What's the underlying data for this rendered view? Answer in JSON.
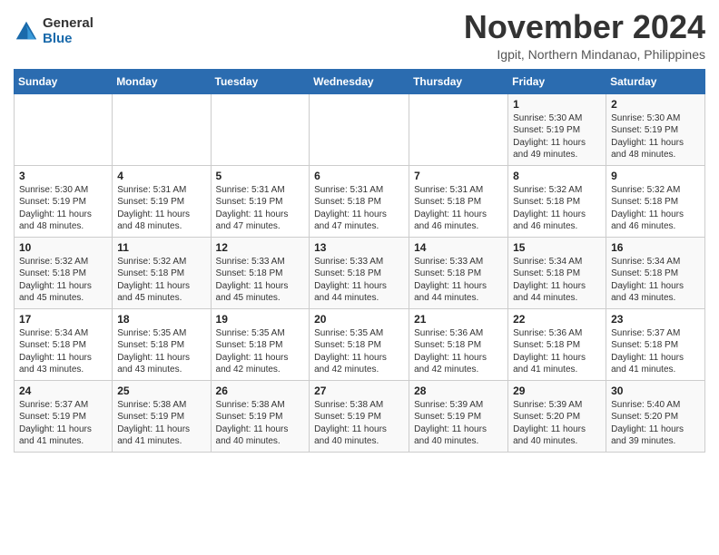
{
  "header": {
    "logo_general": "General",
    "logo_blue": "Blue",
    "month_title": "November 2024",
    "location": "Igpit, Northern Mindanao, Philippines"
  },
  "weekdays": [
    "Sunday",
    "Monday",
    "Tuesday",
    "Wednesday",
    "Thursday",
    "Friday",
    "Saturday"
  ],
  "weeks": [
    [
      {
        "day": "",
        "content": ""
      },
      {
        "day": "",
        "content": ""
      },
      {
        "day": "",
        "content": ""
      },
      {
        "day": "",
        "content": ""
      },
      {
        "day": "",
        "content": ""
      },
      {
        "day": "1",
        "content": "Sunrise: 5:30 AM\nSunset: 5:19 PM\nDaylight: 11 hours and 49 minutes."
      },
      {
        "day": "2",
        "content": "Sunrise: 5:30 AM\nSunset: 5:19 PM\nDaylight: 11 hours and 48 minutes."
      }
    ],
    [
      {
        "day": "3",
        "content": "Sunrise: 5:30 AM\nSunset: 5:19 PM\nDaylight: 11 hours and 48 minutes."
      },
      {
        "day": "4",
        "content": "Sunrise: 5:31 AM\nSunset: 5:19 PM\nDaylight: 11 hours and 48 minutes."
      },
      {
        "day": "5",
        "content": "Sunrise: 5:31 AM\nSunset: 5:19 PM\nDaylight: 11 hours and 47 minutes."
      },
      {
        "day": "6",
        "content": "Sunrise: 5:31 AM\nSunset: 5:18 PM\nDaylight: 11 hours and 47 minutes."
      },
      {
        "day": "7",
        "content": "Sunrise: 5:31 AM\nSunset: 5:18 PM\nDaylight: 11 hours and 46 minutes."
      },
      {
        "day": "8",
        "content": "Sunrise: 5:32 AM\nSunset: 5:18 PM\nDaylight: 11 hours and 46 minutes."
      },
      {
        "day": "9",
        "content": "Sunrise: 5:32 AM\nSunset: 5:18 PM\nDaylight: 11 hours and 46 minutes."
      }
    ],
    [
      {
        "day": "10",
        "content": "Sunrise: 5:32 AM\nSunset: 5:18 PM\nDaylight: 11 hours and 45 minutes."
      },
      {
        "day": "11",
        "content": "Sunrise: 5:32 AM\nSunset: 5:18 PM\nDaylight: 11 hours and 45 minutes."
      },
      {
        "day": "12",
        "content": "Sunrise: 5:33 AM\nSunset: 5:18 PM\nDaylight: 11 hours and 45 minutes."
      },
      {
        "day": "13",
        "content": "Sunrise: 5:33 AM\nSunset: 5:18 PM\nDaylight: 11 hours and 44 minutes."
      },
      {
        "day": "14",
        "content": "Sunrise: 5:33 AM\nSunset: 5:18 PM\nDaylight: 11 hours and 44 minutes."
      },
      {
        "day": "15",
        "content": "Sunrise: 5:34 AM\nSunset: 5:18 PM\nDaylight: 11 hours and 44 minutes."
      },
      {
        "day": "16",
        "content": "Sunrise: 5:34 AM\nSunset: 5:18 PM\nDaylight: 11 hours and 43 minutes."
      }
    ],
    [
      {
        "day": "17",
        "content": "Sunrise: 5:34 AM\nSunset: 5:18 PM\nDaylight: 11 hours and 43 minutes."
      },
      {
        "day": "18",
        "content": "Sunrise: 5:35 AM\nSunset: 5:18 PM\nDaylight: 11 hours and 43 minutes."
      },
      {
        "day": "19",
        "content": "Sunrise: 5:35 AM\nSunset: 5:18 PM\nDaylight: 11 hours and 42 minutes."
      },
      {
        "day": "20",
        "content": "Sunrise: 5:35 AM\nSunset: 5:18 PM\nDaylight: 11 hours and 42 minutes."
      },
      {
        "day": "21",
        "content": "Sunrise: 5:36 AM\nSunset: 5:18 PM\nDaylight: 11 hours and 42 minutes."
      },
      {
        "day": "22",
        "content": "Sunrise: 5:36 AM\nSunset: 5:18 PM\nDaylight: 11 hours and 41 minutes."
      },
      {
        "day": "23",
        "content": "Sunrise: 5:37 AM\nSunset: 5:18 PM\nDaylight: 11 hours and 41 minutes."
      }
    ],
    [
      {
        "day": "24",
        "content": "Sunrise: 5:37 AM\nSunset: 5:19 PM\nDaylight: 11 hours and 41 minutes."
      },
      {
        "day": "25",
        "content": "Sunrise: 5:38 AM\nSunset: 5:19 PM\nDaylight: 11 hours and 41 minutes."
      },
      {
        "day": "26",
        "content": "Sunrise: 5:38 AM\nSunset: 5:19 PM\nDaylight: 11 hours and 40 minutes."
      },
      {
        "day": "27",
        "content": "Sunrise: 5:38 AM\nSunset: 5:19 PM\nDaylight: 11 hours and 40 minutes."
      },
      {
        "day": "28",
        "content": "Sunrise: 5:39 AM\nSunset: 5:19 PM\nDaylight: 11 hours and 40 minutes."
      },
      {
        "day": "29",
        "content": "Sunrise: 5:39 AM\nSunset: 5:20 PM\nDaylight: 11 hours and 40 minutes."
      },
      {
        "day": "30",
        "content": "Sunrise: 5:40 AM\nSunset: 5:20 PM\nDaylight: 11 hours and 39 minutes."
      }
    ]
  ]
}
